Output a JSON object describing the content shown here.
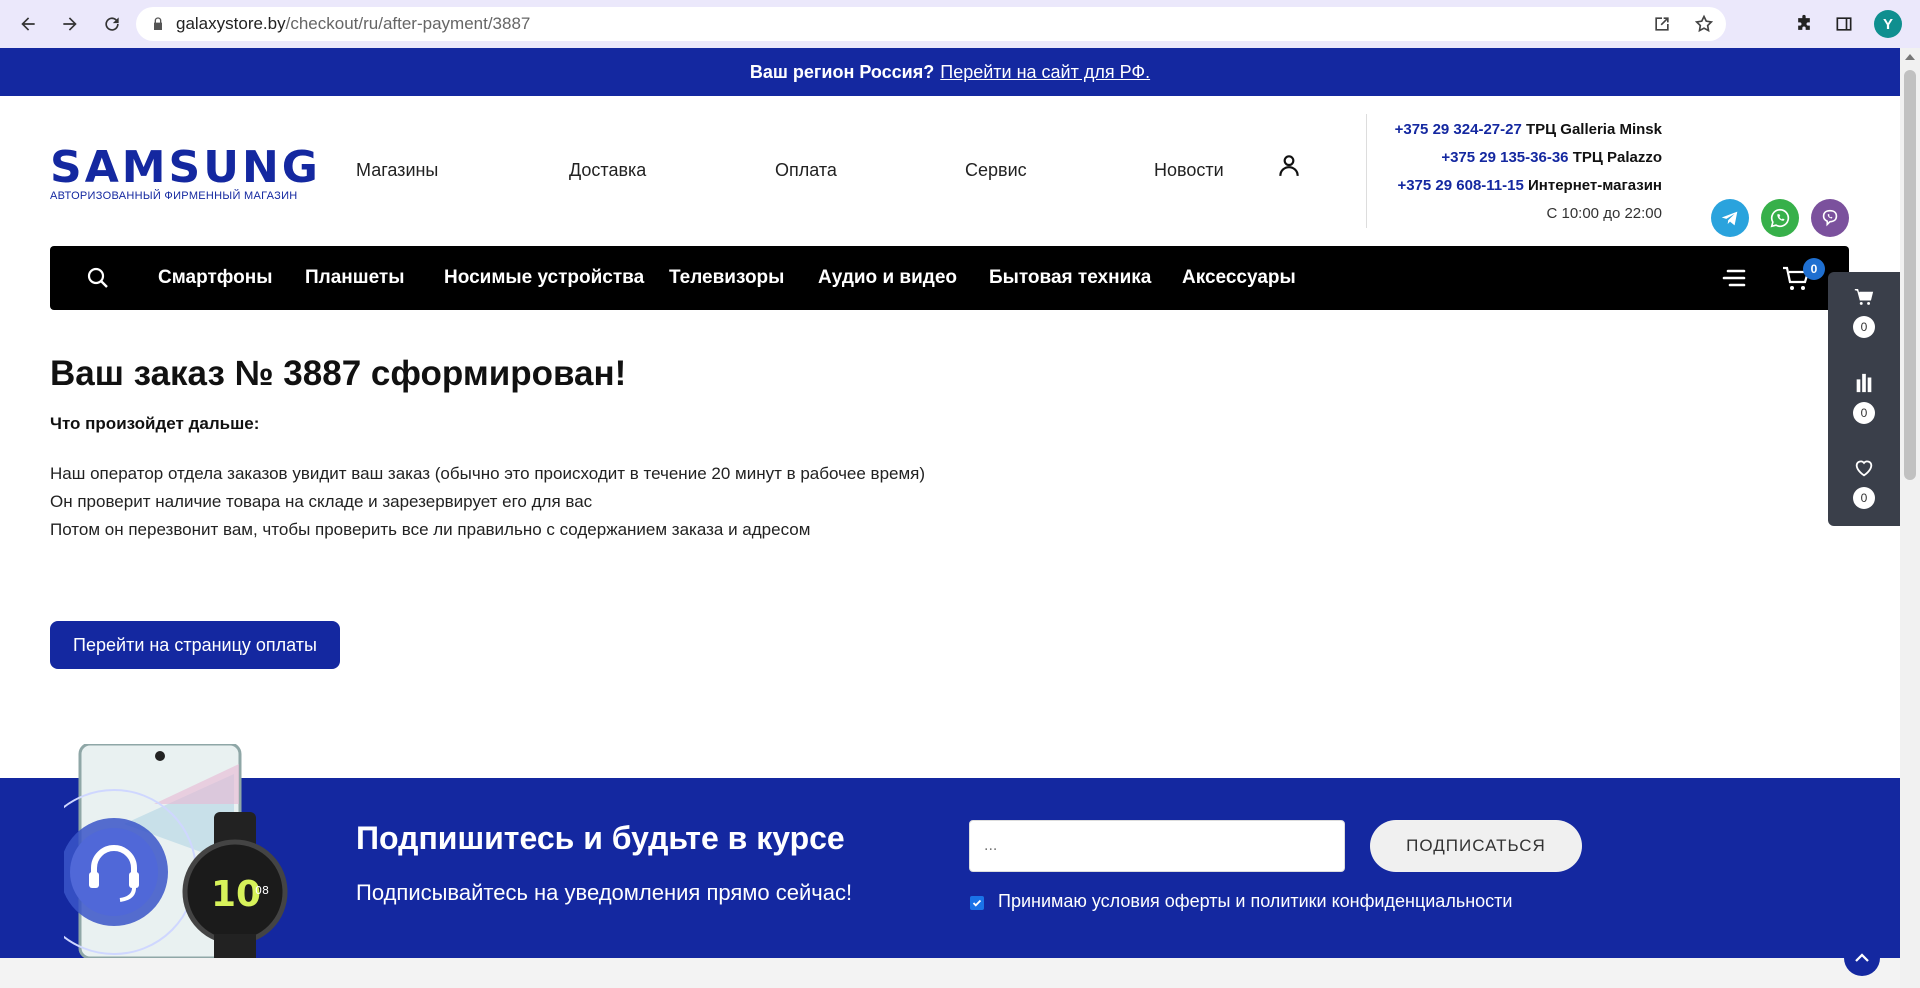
{
  "browser": {
    "url_host": "galaxystore.by",
    "url_path": "/checkout/ru/after-payment/3887",
    "profile_initial": "Y"
  },
  "region_bar": {
    "question": "Ваш регион Россия?",
    "link": "Перейти на сайт для РФ."
  },
  "header": {
    "logo_word": "SAMSUNG",
    "logo_sub": "АВТОРИЗОВАННЫЙ ФИРМЕННЫЙ МАГАЗИН",
    "nav": [
      "Магазины",
      "Доставка",
      "Оплата",
      "Сервис",
      "Новости"
    ],
    "contacts": [
      {
        "phone": "+375 29 324-27-27",
        "place": "ТРЦ Galleria Minsk"
      },
      {
        "phone": "+375 29 135-36-36",
        "place": "ТРЦ Palazzo"
      },
      {
        "phone": "+375 29 608-11-15",
        "place": "Интернет-магазин"
      }
    ],
    "hours": "С 10:00 до 22:00",
    "social": [
      {
        "name": "telegram-icon",
        "color": "#2aa3dd"
      },
      {
        "name": "whatsapp-icon",
        "color": "#37b04a"
      },
      {
        "name": "viber-icon",
        "color": "#7b519d"
      }
    ]
  },
  "categories": [
    "Смартфоны",
    "Планшеты",
    "Носимые устройства",
    "Телевизоры",
    "Аудио и видео",
    "Бытовая техника",
    "Аксессуары"
  ],
  "cart_count": "0",
  "side_panel": {
    "cart": "0",
    "compare": "0",
    "favorites": "0"
  },
  "order": {
    "title": "Ваш заказ № 3887 сформирован!",
    "next_heading": "Что произойдет дальше:",
    "lines": [
      "Наш оператор отдела заказов увидит ваш заказ (обычно это происходит в течение 20 минут в рабочее время)",
      "Он проверит наличие товара на складе и зарезервирует его для вас",
      "Потом он перезвонит вам, чтобы проверить все ли правильно с содержанием заказа и адресом"
    ],
    "pay_button": "Перейти на страницу оплаты"
  },
  "subscribe": {
    "heading": "Подпишитесь и будьте в курсе",
    "subheading": "Подписывайтесь на уведомления прямо сейчас!",
    "email_placeholder": "...",
    "button": "ПОДПИСАТЬСЯ",
    "consent": "Принимаю условия оферты и политики конфиденциальности"
  },
  "colors": {
    "brand": "#1428a0",
    "black_bar": "#000000"
  }
}
